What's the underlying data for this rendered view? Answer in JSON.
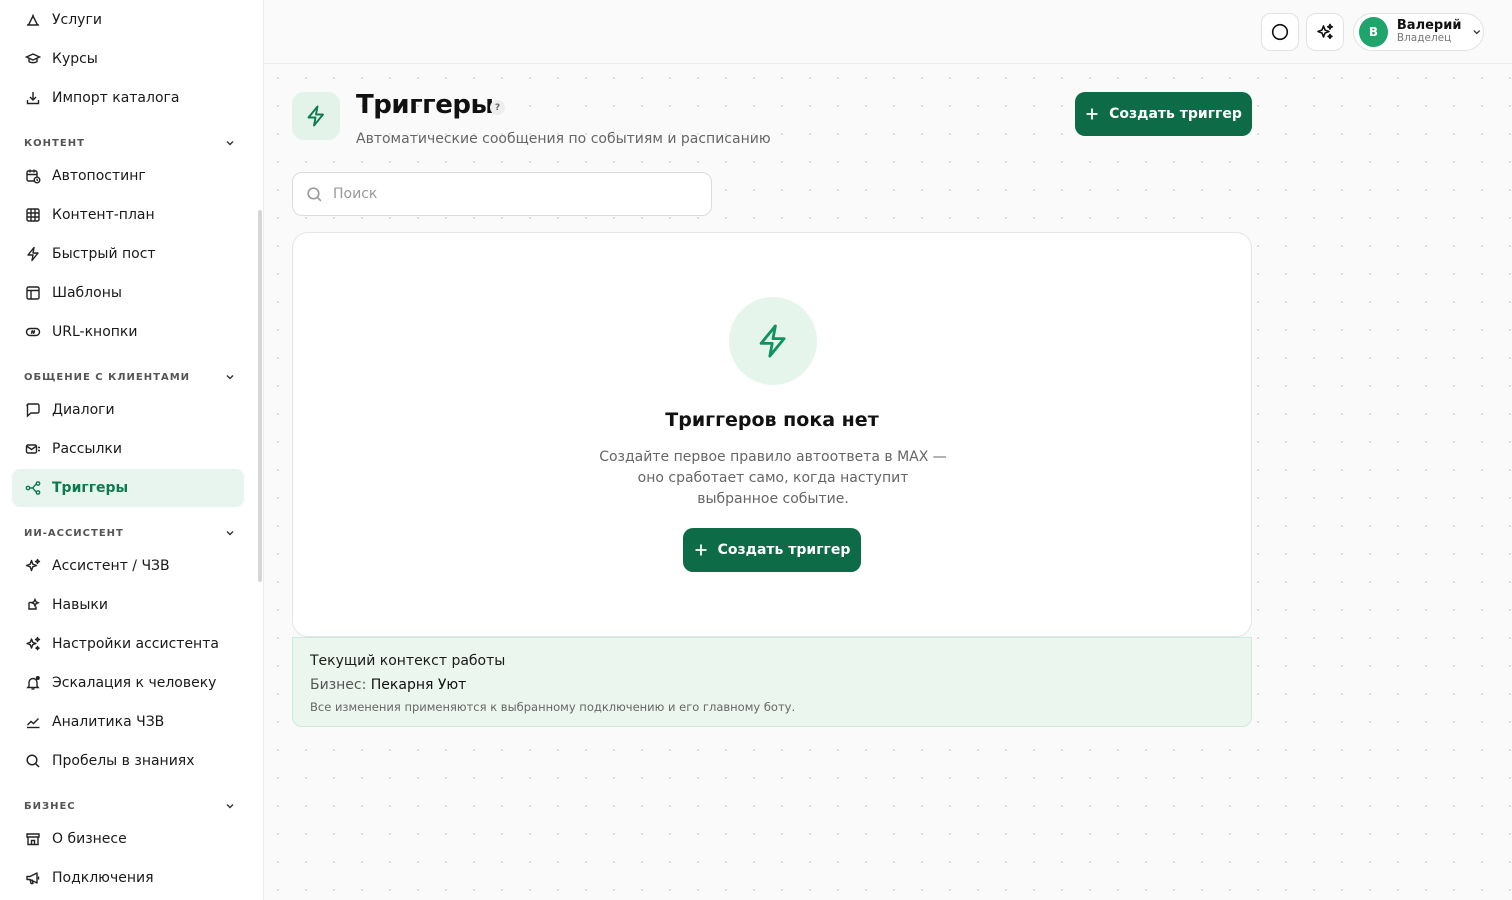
{
  "sidebar": {
    "items_top": [
      {
        "label": "Услуги",
        "icon": "services-icon"
      },
      {
        "label": "Курсы",
        "icon": "graduation-cap-icon"
      },
      {
        "label": "Импорт каталога",
        "icon": "download-icon"
      }
    ],
    "section_content": "КОНТЕНТ",
    "items_content": [
      {
        "label": "Автопостинг",
        "icon": "calendar-clock-icon"
      },
      {
        "label": "Контент-план",
        "icon": "grid-icon"
      },
      {
        "label": "Быстрый пост",
        "icon": "lightning-icon"
      },
      {
        "label": "Шаблоны",
        "icon": "template-icon"
      },
      {
        "label": "URL-кнопки",
        "icon": "link-button-icon"
      }
    ],
    "section_clients": "ОБЩЕНИЕ С КЛИЕНТАМИ",
    "items_clients": [
      {
        "label": "Диалоги",
        "icon": "chat-icon"
      },
      {
        "label": "Рассылки",
        "icon": "mail-send-icon"
      },
      {
        "label": "Триггеры",
        "icon": "workflow-icon"
      }
    ],
    "section_ai": "ИИ-АССИСТЕНТ",
    "items_ai": [
      {
        "label": "Ассистент / ЧЗВ",
        "icon": "sparkles-icon"
      },
      {
        "label": "Навыки",
        "icon": "skill-icon"
      },
      {
        "label": "Настройки ассистента",
        "icon": "sparkles-settings-icon"
      },
      {
        "label": "Эскалация к человеку",
        "icon": "bell-icon"
      },
      {
        "label": "Аналитика ЧЗВ",
        "icon": "chart-line-icon"
      },
      {
        "label": "Пробелы в знаниях",
        "icon": "search-icon"
      }
    ],
    "section_business": "БИЗНЕС",
    "items_business": [
      {
        "label": "О бизнесе",
        "icon": "store-icon"
      },
      {
        "label": "Подключения",
        "icon": "megaphone-icon"
      }
    ]
  },
  "topbar": {
    "user_initial": "В",
    "user_name": "Валерий",
    "user_role": "Владелец"
  },
  "page": {
    "title": "Триггеры",
    "help": "?",
    "subtitle": "Автоматические сообщения по событиям и расписанию",
    "create_button": "Создать триггер",
    "search_placeholder": "Поиск"
  },
  "empty_state": {
    "title": "Триггеров пока нет",
    "text": "Создайте первое правило автоответа в MAX — оно сработает само, когда наступит выбранное событие.",
    "button": "Создать триггер"
  },
  "context": {
    "title": "Текущий контекст работы",
    "business_label": "Бизнес:",
    "business_name": "Пекарня Уют",
    "note": "Все изменения применяются к выбранному подключению и его главному боту."
  },
  "colors": {
    "accent": "#0d6b48",
    "accent_light": "#e8f5ee",
    "avatar": "#1fa46c"
  }
}
